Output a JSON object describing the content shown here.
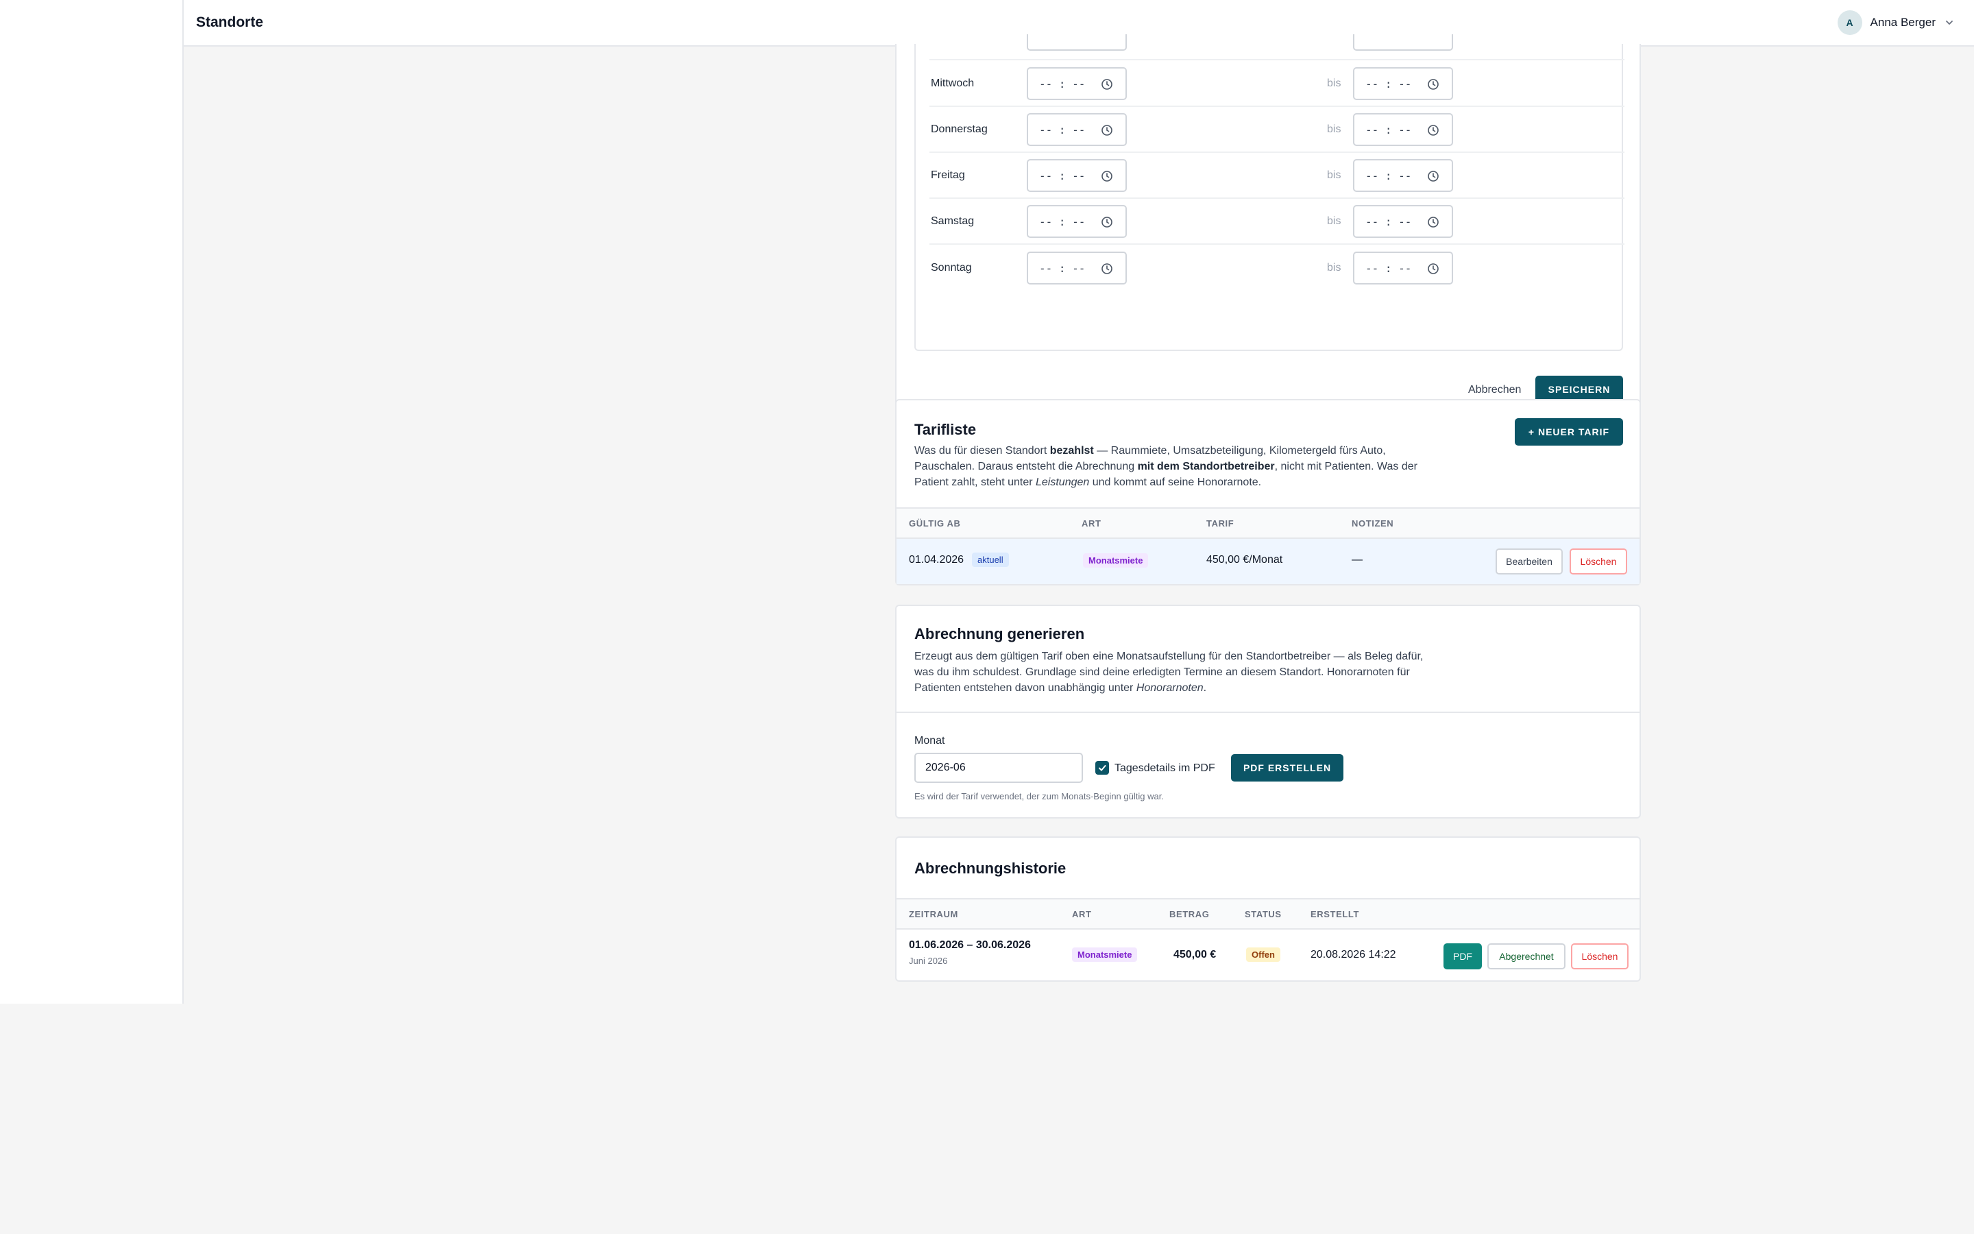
{
  "header": {
    "title": "Standorte",
    "user_initial": "A",
    "user_name": "Anna Berger"
  },
  "hours": {
    "separator": "bis",
    "time_placeholder": "-- : --",
    "days": [
      "Mittwoch",
      "Donnerstag",
      "Freitag",
      "Samstag",
      "Sonntag"
    ],
    "cancel_label": "Abbrechen",
    "save_label": "SPEICHERN"
  },
  "tariffs": {
    "title": "Tarifliste",
    "desc": {
      "p1": "Was du für diesen Standort ",
      "b1": "bezahlst",
      "p2": " — Raummiete, Umsatzbeteiligung, Kilometergeld fürs Auto, Pauschalen. Daraus entsteht die Abrechnung ",
      "b2": "mit dem Standortbetreiber",
      "p3": ", nicht mit Patienten. Was der Patient zahlt, steht unter ",
      "i1": "Leistungen",
      "p4": " und kommt auf seine Honorarnote."
    },
    "new_button": "+ NEUER TARIF",
    "columns": [
      "GÜLTIG AB",
      "ART",
      "TARIF",
      "NOTIZEN"
    ],
    "row": {
      "valid_from": "01.04.2026",
      "current_badge": "aktuell",
      "type": "Monatsmiete",
      "tariff": "450,00 €/Monat",
      "notes": "—",
      "edit_label": "Bearbeiten",
      "delete_label": "Löschen"
    }
  },
  "generate": {
    "title": "Abrechnung generieren",
    "desc": {
      "p1": "Erzeugt aus dem gültigen Tarif oben eine Monatsaufstellung für den Standortbetreiber — als Beleg dafür, was du ihm schuldest. Grundlage sind deine erledigten Termine an diesem Standort. Honorarnoten für Patienten entstehen davon unabhängig unter ",
      "i1": "Honorarnoten",
      "p2": "."
    },
    "month_label": "Monat",
    "month_value": "2026-06",
    "checkbox_label": "Tagesdetails im PDF",
    "checkbox_checked": true,
    "create_button": "PDF ERSTELLEN",
    "hint": "Es wird der Tarif verwendet, der zum Monats-Beginn gültig war."
  },
  "history": {
    "title": "Abrechnungshistorie",
    "columns": [
      "ZEITRAUM",
      "ART",
      "BETRAG",
      "STATUS",
      "ERSTELLT"
    ],
    "row": {
      "period": "01.06.2026 – 30.06.2026",
      "period_sub": "Juni 2026",
      "type": "Monatsmiete",
      "amount": "450,00 €",
      "status": "Offen",
      "created": "20.08.2026 14:22",
      "pdf_label": "PDF",
      "settled_label": "Abgerechnet",
      "delete_label": "Löschen"
    }
  },
  "colors": {
    "primary": "#0b5566",
    "pdf_button": "#0f8a7e",
    "danger": "#dc2626",
    "badge_purple": "#7e22ce",
    "badge_offen": "#92400e"
  }
}
